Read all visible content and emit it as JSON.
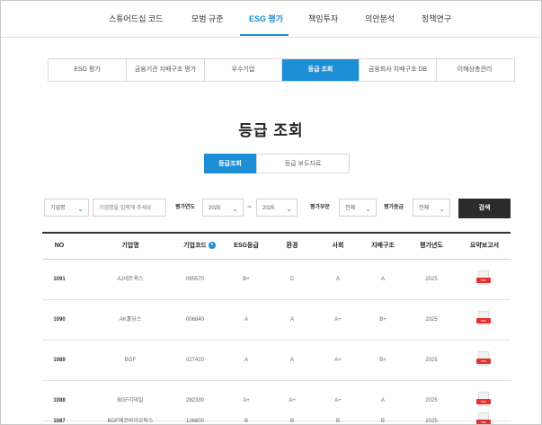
{
  "topnav": {
    "items": [
      "스튜어드십 코드",
      "모범 규준",
      "ESG 평가",
      "책임투자",
      "의안분석",
      "정책연구"
    ],
    "active_index": 2
  },
  "subtabs": {
    "items": [
      "ESG 평가",
      "금융기관 지배구조 평가",
      "우수기업",
      "등급 조회",
      "금융회사 지배구조 DB",
      "이해상충관리"
    ],
    "active_index": 3
  },
  "page": {
    "title": "등급 조회"
  },
  "toggle": {
    "on_label": "등급조회",
    "off_label": "등급 보도자료"
  },
  "filters": {
    "company_select": "기업명",
    "company_input_placeholder": "기업명을 입력해 주세요",
    "year_label": "평가연도",
    "year_from": "2025",
    "tilde": "~",
    "year_to": "2025",
    "category_label": "평가부문",
    "category_value": "전체",
    "grade_label": "평가등급",
    "grade_value": "전체",
    "search_button": "검색"
  },
  "table": {
    "headers": [
      "NO",
      "기업명",
      "기업코드",
      "ESG등급",
      "환경",
      "사회",
      "지배구조",
      "평가년도",
      "요약보고서"
    ],
    "rows": [
      [
        "1091",
        "AJ네트웍스",
        "095570",
        "B+",
        "C",
        "A",
        "A",
        "2025"
      ],
      [
        "1090",
        "AK홀딩스",
        "006840",
        "A",
        "A",
        "A+",
        "B+",
        "2025"
      ],
      [
        "1089",
        "BGF",
        "027410",
        "A",
        "A",
        "A+",
        "B+",
        "2025"
      ],
      [
        "1088",
        "BGF리테일",
        "282330",
        "A+",
        "A+",
        "A+",
        "A",
        "2025"
      ],
      [
        "1087",
        "BGF에코바이오틱스",
        "126600",
        "B",
        "B",
        "B",
        "B",
        "2025"
      ]
    ],
    "pdf_badge": "PDF"
  },
  "colors": {
    "accent": "#1d8fd6",
    "search_button": "#2b2b2b",
    "pdf": "#e0322e"
  }
}
